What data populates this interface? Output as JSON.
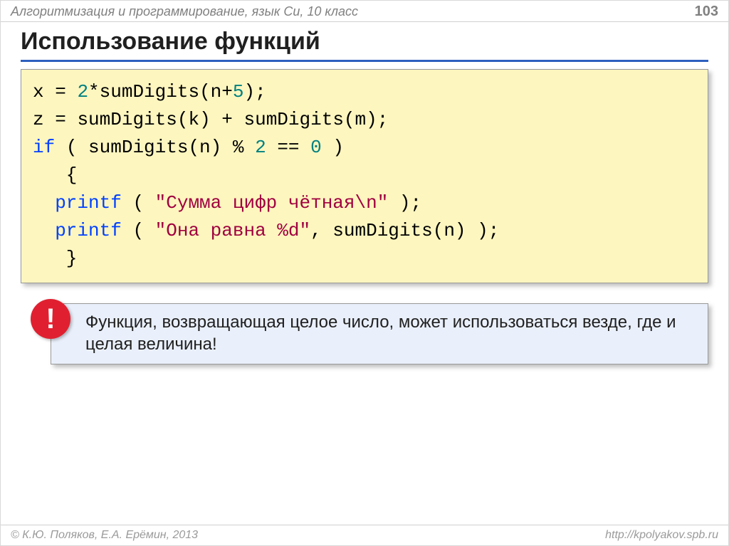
{
  "header": {
    "left": "Алгоритмизация и программирование, язык Си, 10 класс",
    "right": "103"
  },
  "title": "Использование функций",
  "code": {
    "l1a": "x",
    "l1b": "=",
    "l1c": "2",
    "l1d": "*sumDigits(n+",
    "l1e": "5",
    "l1f": ");",
    "l2a": "z",
    "l2b": "=",
    "l2c": "sumDigits(k)",
    "l2d": "+",
    "l2e": "sumDigits(m);",
    "l3a": "if",
    "l3b": "( sumDigits(n)",
    "l3c": "%",
    "l3d": "2",
    "l3e": "==",
    "l3f": "0",
    "l3g": " )",
    "l4": "   {",
    "l5a": "  printf",
    "l5b": "(",
    "l5c": " \"Сумма цифр чётная\\n\" ",
    "l5d": ");",
    "l6a": "  printf",
    "l6b": "(",
    "l6c": " \"Она равна %d\"",
    "l6d": ", sumDigits(n) );",
    "l7": "   }"
  },
  "note": {
    "mark": "!",
    "text": "Функция, возвращающая целое число, может использоваться везде, где и целая величина!"
  },
  "footer": {
    "left": "© К.Ю. Поляков, Е.А. Ерёмин, 2013",
    "right": "http://kpolyakov.spb.ru"
  }
}
